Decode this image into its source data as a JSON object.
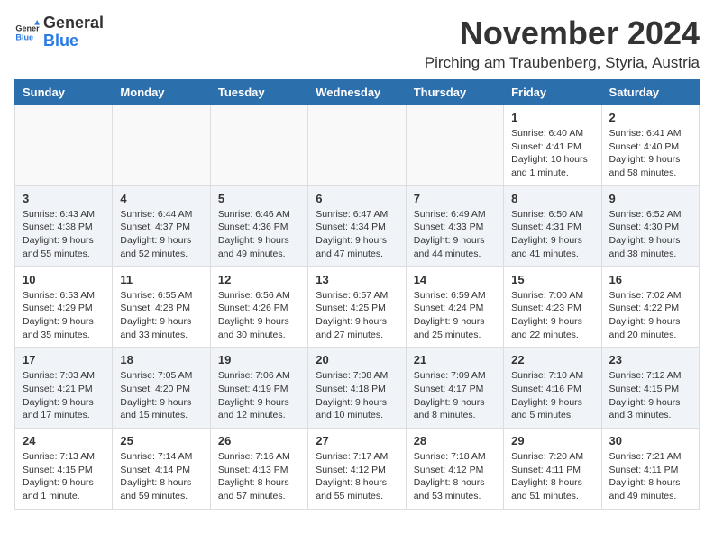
{
  "logo": {
    "general": "General",
    "blue": "Blue"
  },
  "title": "November 2024",
  "subtitle": "Pirching am Traubenberg, Styria, Austria",
  "weekdays": [
    "Sunday",
    "Monday",
    "Tuesday",
    "Wednesday",
    "Thursday",
    "Friday",
    "Saturday"
  ],
  "weeks": [
    [
      {
        "day": "",
        "info": ""
      },
      {
        "day": "",
        "info": ""
      },
      {
        "day": "",
        "info": ""
      },
      {
        "day": "",
        "info": ""
      },
      {
        "day": "",
        "info": ""
      },
      {
        "day": "1",
        "info": "Sunrise: 6:40 AM\nSunset: 4:41 PM\nDaylight: 10 hours and 1 minute."
      },
      {
        "day": "2",
        "info": "Sunrise: 6:41 AM\nSunset: 4:40 PM\nDaylight: 9 hours and 58 minutes."
      }
    ],
    [
      {
        "day": "3",
        "info": "Sunrise: 6:43 AM\nSunset: 4:38 PM\nDaylight: 9 hours and 55 minutes."
      },
      {
        "day": "4",
        "info": "Sunrise: 6:44 AM\nSunset: 4:37 PM\nDaylight: 9 hours and 52 minutes."
      },
      {
        "day": "5",
        "info": "Sunrise: 6:46 AM\nSunset: 4:36 PM\nDaylight: 9 hours and 49 minutes."
      },
      {
        "day": "6",
        "info": "Sunrise: 6:47 AM\nSunset: 4:34 PM\nDaylight: 9 hours and 47 minutes."
      },
      {
        "day": "7",
        "info": "Sunrise: 6:49 AM\nSunset: 4:33 PM\nDaylight: 9 hours and 44 minutes."
      },
      {
        "day": "8",
        "info": "Sunrise: 6:50 AM\nSunset: 4:31 PM\nDaylight: 9 hours and 41 minutes."
      },
      {
        "day": "9",
        "info": "Sunrise: 6:52 AM\nSunset: 4:30 PM\nDaylight: 9 hours and 38 minutes."
      }
    ],
    [
      {
        "day": "10",
        "info": "Sunrise: 6:53 AM\nSunset: 4:29 PM\nDaylight: 9 hours and 35 minutes."
      },
      {
        "day": "11",
        "info": "Sunrise: 6:55 AM\nSunset: 4:28 PM\nDaylight: 9 hours and 33 minutes."
      },
      {
        "day": "12",
        "info": "Sunrise: 6:56 AM\nSunset: 4:26 PM\nDaylight: 9 hours and 30 minutes."
      },
      {
        "day": "13",
        "info": "Sunrise: 6:57 AM\nSunset: 4:25 PM\nDaylight: 9 hours and 27 minutes."
      },
      {
        "day": "14",
        "info": "Sunrise: 6:59 AM\nSunset: 4:24 PM\nDaylight: 9 hours and 25 minutes."
      },
      {
        "day": "15",
        "info": "Sunrise: 7:00 AM\nSunset: 4:23 PM\nDaylight: 9 hours and 22 minutes."
      },
      {
        "day": "16",
        "info": "Sunrise: 7:02 AM\nSunset: 4:22 PM\nDaylight: 9 hours and 20 minutes."
      }
    ],
    [
      {
        "day": "17",
        "info": "Sunrise: 7:03 AM\nSunset: 4:21 PM\nDaylight: 9 hours and 17 minutes."
      },
      {
        "day": "18",
        "info": "Sunrise: 7:05 AM\nSunset: 4:20 PM\nDaylight: 9 hours and 15 minutes."
      },
      {
        "day": "19",
        "info": "Sunrise: 7:06 AM\nSunset: 4:19 PM\nDaylight: 9 hours and 12 minutes."
      },
      {
        "day": "20",
        "info": "Sunrise: 7:08 AM\nSunset: 4:18 PM\nDaylight: 9 hours and 10 minutes."
      },
      {
        "day": "21",
        "info": "Sunrise: 7:09 AM\nSunset: 4:17 PM\nDaylight: 9 hours and 8 minutes."
      },
      {
        "day": "22",
        "info": "Sunrise: 7:10 AM\nSunset: 4:16 PM\nDaylight: 9 hours and 5 minutes."
      },
      {
        "day": "23",
        "info": "Sunrise: 7:12 AM\nSunset: 4:15 PM\nDaylight: 9 hours and 3 minutes."
      }
    ],
    [
      {
        "day": "24",
        "info": "Sunrise: 7:13 AM\nSunset: 4:15 PM\nDaylight: 9 hours and 1 minute."
      },
      {
        "day": "25",
        "info": "Sunrise: 7:14 AM\nSunset: 4:14 PM\nDaylight: 8 hours and 59 minutes."
      },
      {
        "day": "26",
        "info": "Sunrise: 7:16 AM\nSunset: 4:13 PM\nDaylight: 8 hours and 57 minutes."
      },
      {
        "day": "27",
        "info": "Sunrise: 7:17 AM\nSunset: 4:12 PM\nDaylight: 8 hours and 55 minutes."
      },
      {
        "day": "28",
        "info": "Sunrise: 7:18 AM\nSunset: 4:12 PM\nDaylight: 8 hours and 53 minutes."
      },
      {
        "day": "29",
        "info": "Sunrise: 7:20 AM\nSunset: 4:11 PM\nDaylight: 8 hours and 51 minutes."
      },
      {
        "day": "30",
        "info": "Sunrise: 7:21 AM\nSunset: 4:11 PM\nDaylight: 8 hours and 49 minutes."
      }
    ]
  ]
}
